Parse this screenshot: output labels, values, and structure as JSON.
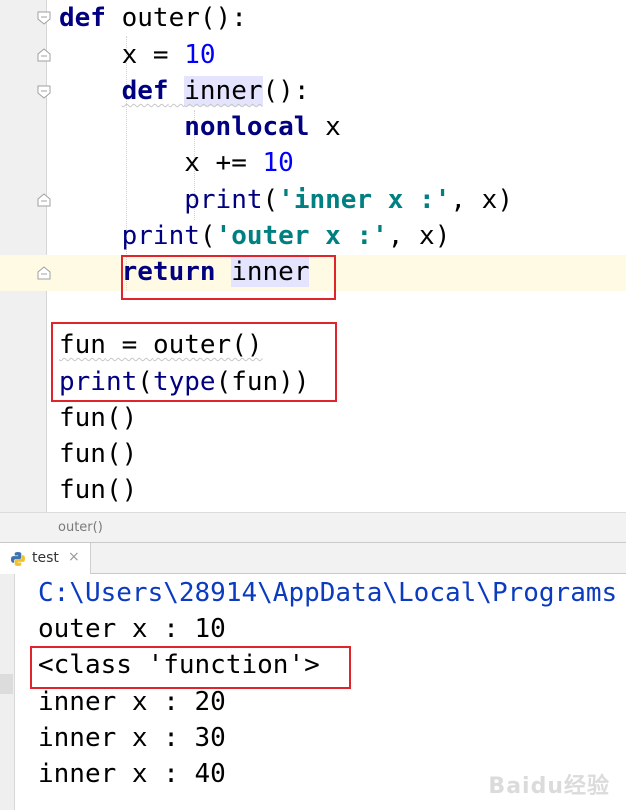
{
  "editor": {
    "lines": [
      {
        "kw1": "def",
        "sp1": " ",
        "name": "outer",
        "rest": "():"
      },
      {
        "indent": "    ",
        "var": "x",
        "op": " = ",
        "num": "10"
      },
      {
        "indent": "    ",
        "kw1": "def",
        "sp1": " ",
        "name": "inner",
        "rest": "():"
      },
      {
        "indent": "        ",
        "kw1": "nonlocal",
        "sp1": " ",
        "var": "x"
      },
      {
        "indent": "        ",
        "var": "x",
        "op": " += ",
        "num": "10"
      },
      {
        "indent": "        ",
        "fn": "print",
        "open": "(",
        "str": "'inner x :'",
        "rest": ", x)"
      },
      {
        "indent": "    ",
        "fn": "print",
        "open": "(",
        "str": "'outer x :'",
        "rest": ", x)"
      },
      {
        "indent": "    ",
        "kw1": "return",
        "sp1": " ",
        "name": "inner"
      },
      {
        "text": ""
      },
      {
        "var": "fun",
        "op": " = ",
        "call": "outer()"
      },
      {
        "fn": "print",
        "open": "(",
        "fn2": "type",
        "rest": "(fun))"
      },
      {
        "text": "fun()"
      },
      {
        "text": "fun()"
      },
      {
        "text": "fun()"
      }
    ]
  },
  "breadcrumb": "outer()",
  "run": {
    "tab_label": "test",
    "tab_close": "×",
    "tab_icon": "python-icon",
    "output": [
      "C:\\Users\\28914\\AppData\\Local\\Programs",
      "outer x : 10",
      "<class 'function'>",
      "inner x : 20",
      "inner x : 30",
      "inner x : 40"
    ]
  },
  "watermark": "Baidu经验",
  "colors": {
    "keyword": "#000080",
    "number": "#0000ff",
    "string": "#008080",
    "highlight_box": "#e0242b",
    "caret_row": "#fffae3"
  }
}
